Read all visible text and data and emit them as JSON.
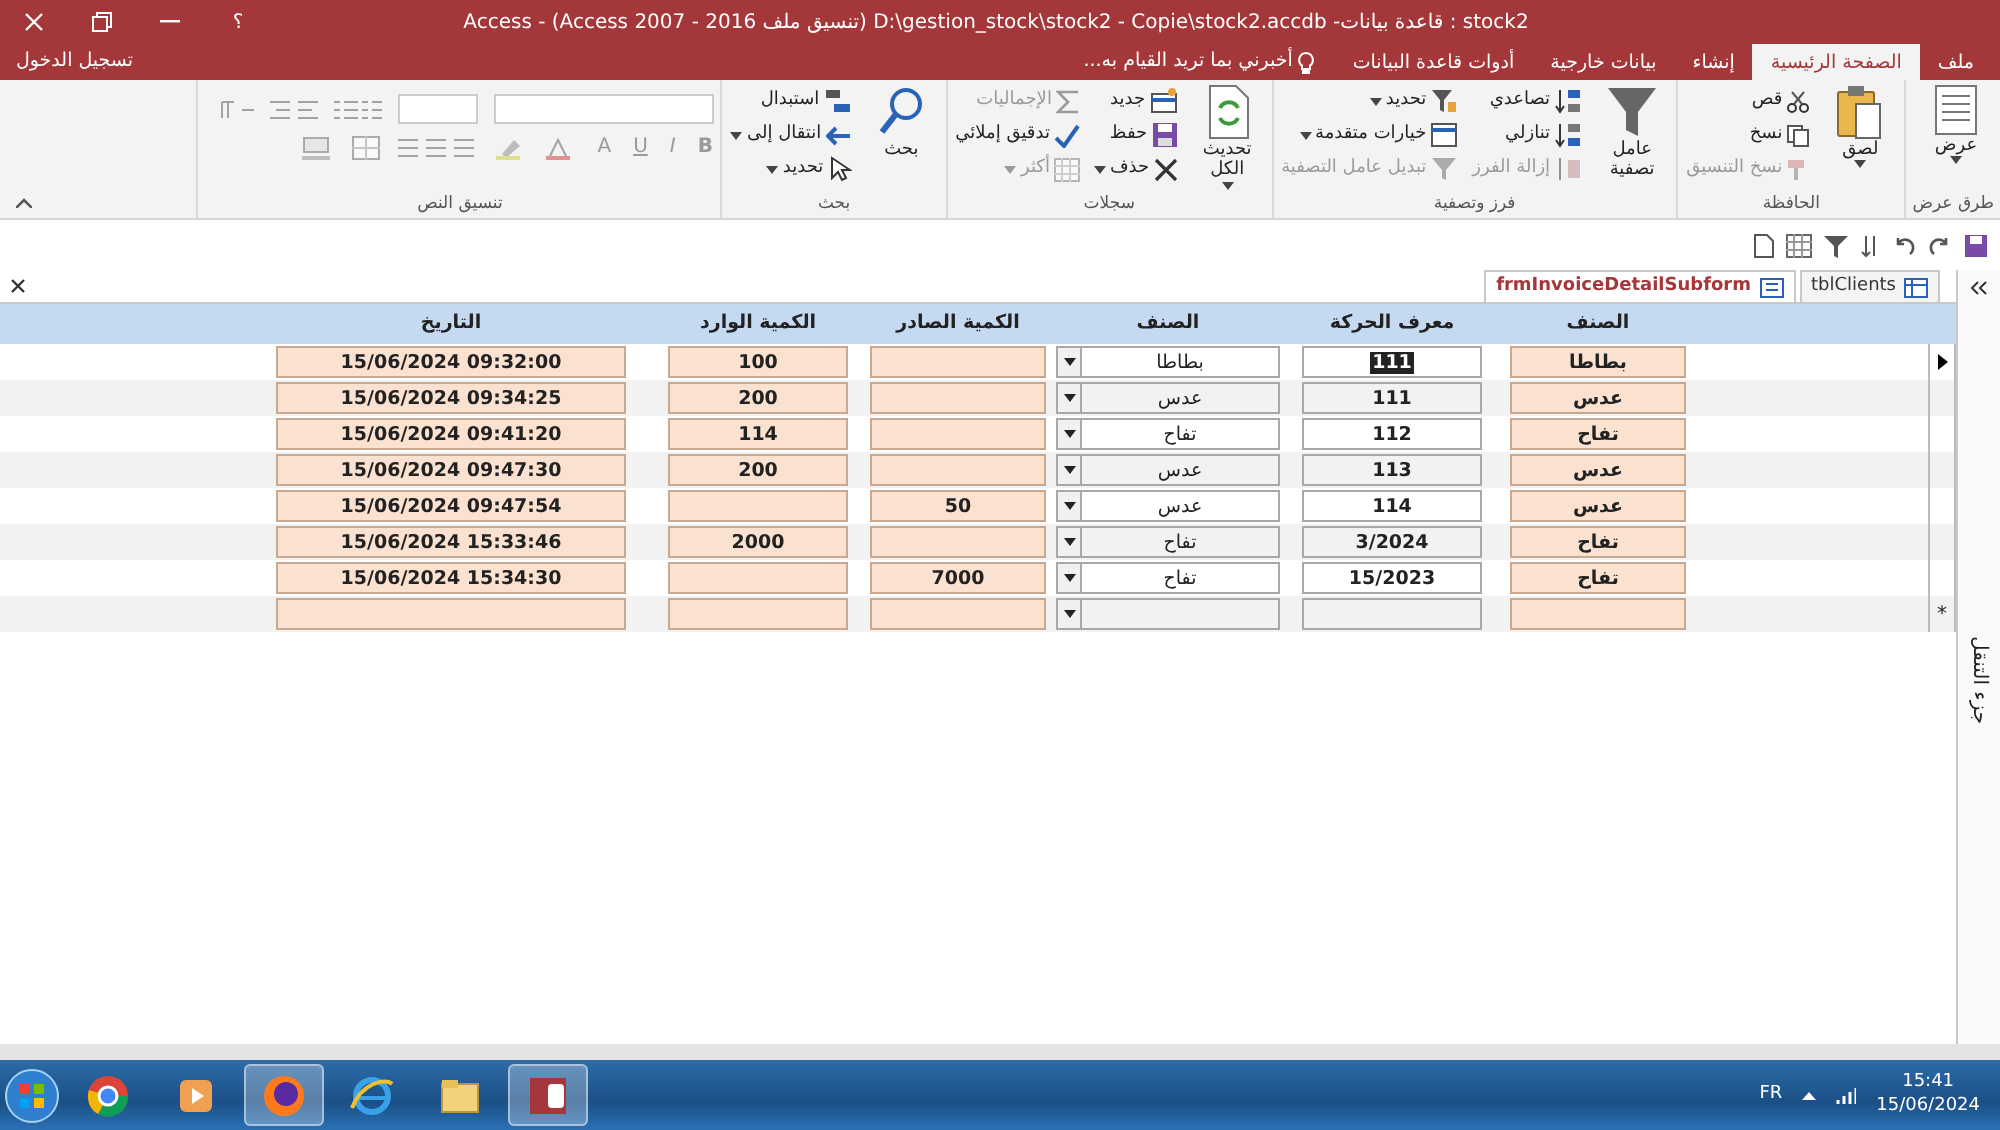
{
  "window": {
    "title": "stock2 : قاعدة بيانات- D:\\gestion_stock\\stock2 - Copie\\stock2.accdb (تنسيق ملف Access 2007 - 2016) - Access",
    "help": "؟"
  },
  "ribbon_tabs": [
    {
      "label": "ملف",
      "selected": false
    },
    {
      "label": "الصفحة الرئيسية",
      "selected": true
    },
    {
      "label": "إنشاء",
      "selected": false
    },
    {
      "label": "بيانات خارجية",
      "selected": false
    },
    {
      "label": "أدوات قاعدة البيانات",
      "selected": false
    }
  ],
  "tell_me": {
    "placeholder": "أخبرني بما تريد القيام به..."
  },
  "sign_in": "تسجيل الدخول",
  "ribbon": {
    "groups": [
      {
        "label": "طرق عرض",
        "items": [
          {
            "kind": "large",
            "label": "عرض",
            "has_menu": true,
            "disabled": false
          }
        ]
      },
      {
        "label": "الحافظة",
        "items": [
          {
            "kind": "large",
            "label": "لصق",
            "has_menu": true,
            "disabled": false
          },
          {
            "kind": "small",
            "label": "قص",
            "has_menu": false,
            "disabled": false
          },
          {
            "kind": "small",
            "label": "نسخ",
            "has_menu": false,
            "disabled": false
          },
          {
            "kind": "small",
            "label": "نسخ التنسيق",
            "has_menu": false,
            "disabled": true
          }
        ]
      },
      {
        "label": "فرز وتصفية",
        "items": [
          {
            "kind": "large",
            "label": "عامل تصفية",
            "has_menu": false,
            "disabled": false
          },
          {
            "kind": "small",
            "label": "تصاعدي",
            "has_menu": false,
            "disabled": false
          },
          {
            "kind": "small",
            "label": "تنازلي",
            "has_menu": false,
            "disabled": false
          },
          {
            "kind": "small",
            "label": "إزالة الفرز",
            "has_menu": false,
            "disabled": true
          },
          {
            "kind": "small",
            "label": "تحديد",
            "has_menu": true,
            "disabled": false
          },
          {
            "kind": "small",
            "label": "خيارات متقدمة",
            "has_menu": true,
            "disabled": false
          },
          {
            "kind": "small",
            "label": "تبديل عامل التصفية",
            "has_menu": false,
            "disabled": true
          }
        ]
      },
      {
        "label": "سجلات",
        "items": [
          {
            "kind": "large",
            "label": "تحديث الكل",
            "has_menu": true,
            "disabled": false
          },
          {
            "kind": "small",
            "label": "جديد",
            "has_menu": false,
            "disabled": false
          },
          {
            "kind": "small",
            "label": "حفظ",
            "has_menu": false,
            "disabled": false
          },
          {
            "kind": "small",
            "label": "حذف",
            "has_menu": true,
            "disabled": false
          },
          {
            "kind": "small",
            "label": "الإجماليات",
            "has_menu": false,
            "disabled": true
          },
          {
            "kind": "small",
            "label": "تدقيق إملائي",
            "has_menu": false,
            "disabled": false
          },
          {
            "kind": "small",
            "label": "أكثر",
            "has_menu": true,
            "disabled": true
          }
        ]
      },
      {
        "label": "بحث",
        "items": [
          {
            "kind": "large",
            "label": "بحث",
            "has_menu": false,
            "disabled": false
          },
          {
            "kind": "small",
            "label": "استبدال",
            "has_menu": false,
            "disabled": false
          },
          {
            "kind": "small",
            "label": "انتقال إلى",
            "has_menu": true,
            "disabled": false
          },
          {
            "kind": "small",
            "label": "تحديد",
            "has_menu": true,
            "disabled": false
          }
        ]
      },
      {
        "label": "تنسيق النص",
        "kind": "format",
        "disabled": true,
        "letters": [
          "B",
          "I",
          "U",
          "A"
        ]
      }
    ]
  },
  "doc_tabs": [
    {
      "label": "tblClients",
      "selected": false
    },
    {
      "label": "frmInvoiceDetailSubform",
      "selected": true
    }
  ],
  "form": {
    "headers": [
      "الصنف",
      "معرف الحركة",
      "الصنف",
      "الكمية الصادر",
      "الكمية الوارد",
      "التاريخ"
    ],
    "rows": [
      {
        "kind": "record",
        "selected": true,
        "item": "بطاطا",
        "movement_id": "111",
        "item_choice": "بطاطا",
        "qty_in": "100",
        "date": "15/06/2024 09:32:00"
      },
      {
        "kind": "record",
        "selected": false,
        "item": "عدس",
        "movement_id": "111",
        "item_choice": "عدس",
        "qty_in": "200",
        "date": "15/06/2024 09:34:25"
      },
      {
        "kind": "record",
        "selected": false,
        "item": "تفاح",
        "movement_id": "112",
        "item_choice": "تفاح",
        "qty_in": "114",
        "date": "15/06/2024 09:41:20"
      },
      {
        "kind": "record",
        "selected": false,
        "item": "عدس",
        "movement_id": "113",
        "item_choice": "عدس",
        "qty_in": "200",
        "date": "15/06/2024 09:47:30"
      },
      {
        "kind": "record",
        "selected": false,
        "item": "عدس",
        "movement_id": "114",
        "item_choice": "عدس",
        "qty_out": "50",
        "date": "15/06/2024 09:47:54"
      },
      {
        "kind": "record",
        "selected": false,
        "item": "تفاح",
        "movement_id": "3/2024",
        "item_choice": "تفاح",
        "qty_in": "2000",
        "date": "15/06/2024 15:33:46"
      },
      {
        "kind": "record",
        "selected": false,
        "item": "تفاح",
        "movement_id": "15/2023",
        "item_choice": "تفاح",
        "qty_out": "7000",
        "date": "15/06/2024 15:34:30"
      },
      {
        "kind": "new",
        "selected": false,
        "marker": "*"
      }
    ]
  },
  "nav_pane": {
    "label": "جزء التنقل"
  },
  "taskbar": {
    "apps": [
      {
        "active": false
      },
      {
        "active": false
      },
      {
        "active": true
      },
      {
        "active": false
      },
      {
        "active": false
      },
      {
        "active": true
      }
    ],
    "language": "FR",
    "time": "15:41",
    "date": "15/06/2024"
  }
}
